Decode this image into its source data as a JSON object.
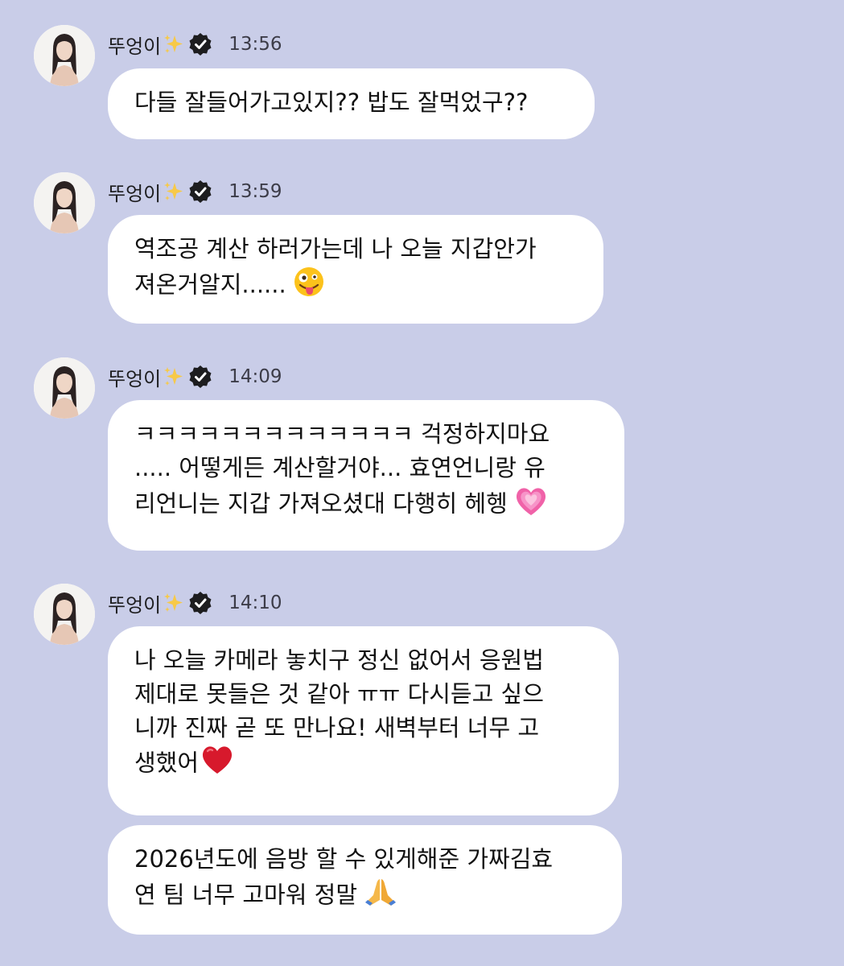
{
  "sender": {
    "name": "뚜엉이",
    "sparkle_icon": "sparkles-icon",
    "verified_icon": "verified-badge-icon"
  },
  "messages": [
    {
      "time": "13:56",
      "lines": [
        "다들 잘들어가고있지?? 밥도 잘먹었구??"
      ]
    },
    {
      "time": "13:59",
      "lines": [
        "역조공 계산 하러가는데 나 오늘 지갑안가",
        "져온거알지......"
      ],
      "emoji": "zany-face-emoji"
    },
    {
      "time": "14:09",
      "lines": [
        "ㅋㅋㅋㅋㅋㅋㅋㅋㅋㅋㅋㅋㅋ 걱정하지마요",
        "..... 어떻게든 계산할거야... 효연언니랑 유",
        "리언니는 지갑 가져오셨대 다행히 헤헹"
      ],
      "emoji": "growing-heart-emoji"
    },
    {
      "time": "14:10",
      "lines": [
        "나 오늘 카메라 놓치구 정신 없어서 응원법",
        "제대로 못들은 것 같아 ㅠㅠ 다시듣고 싶으",
        "니까 진짜 곧 또 만나요! 새벽부터 너무 고",
        "생했어"
      ],
      "emoji": "red-heart-emoji"
    },
    {
      "lines": [
        "2026년도에 음방 할 수 있게해준 가짜김효",
        "연 팀 너무 고마워 정말"
      ],
      "emoji": "folded-hands-emoji"
    }
  ],
  "colors": {
    "background": "#c9cde8",
    "bubble": "#ffffff",
    "text": "#111111",
    "verified": "#1d1d1f"
  }
}
